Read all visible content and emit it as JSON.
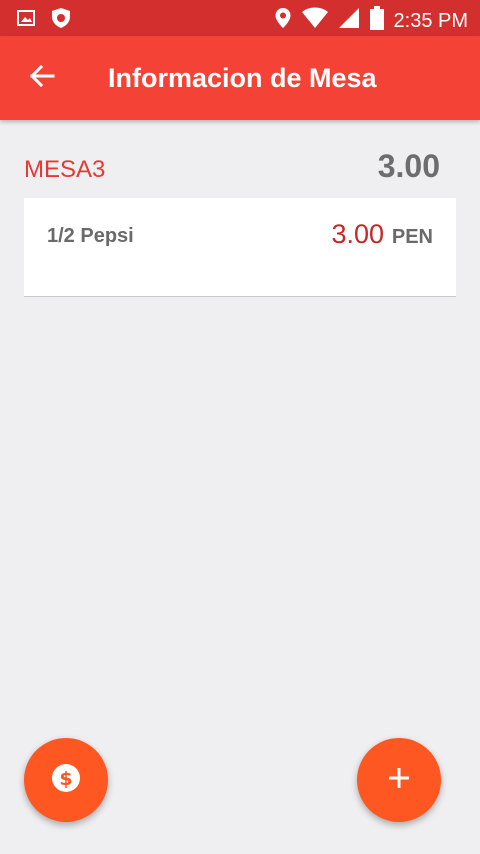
{
  "status_bar": {
    "time": "2:35 PM",
    "icons": [
      "gallery-icon",
      "shield-icon",
      "location-icon",
      "wifi-icon",
      "signal-icon",
      "battery-icon"
    ]
  },
  "app_bar": {
    "title": "Informacion de Mesa",
    "back_icon": "arrow-left-icon"
  },
  "table": {
    "name": "MESA3",
    "total": "3.00"
  },
  "order": {
    "items": [
      {
        "name": "1/2 Pepsi",
        "price": "3.00",
        "currency": "PEN"
      }
    ]
  },
  "actions": {
    "pay_icon": "dollar-coin-icon",
    "add_icon": "plus-icon"
  },
  "colors": {
    "status_bar": "#d32f2f",
    "app_bar": "#f44336",
    "accent": "#e53935",
    "fab": "#ff5722",
    "background": "#efeff2"
  }
}
